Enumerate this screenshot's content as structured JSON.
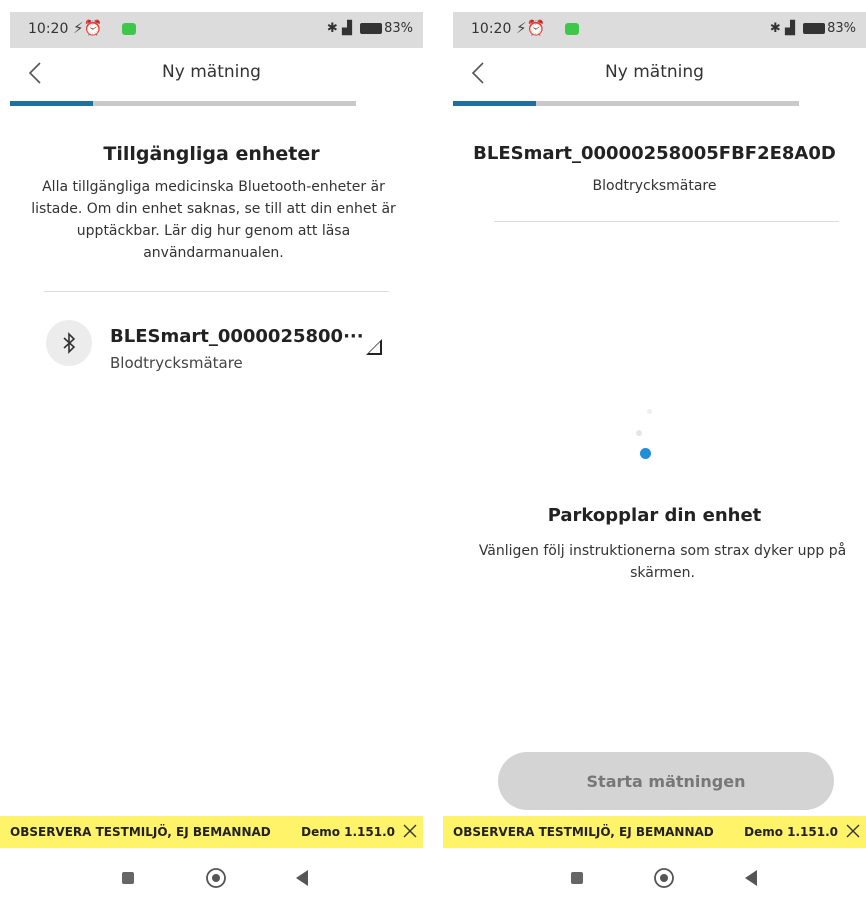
{
  "status_bar": {
    "time": "10:20",
    "right_text": "83",
    "percent_sign": "%",
    "icons": [
      "notification-icon",
      "alarm-icon",
      "app-icon",
      "bluetooth-icon",
      "sim-icon",
      "signal-4g-icon",
      "battery-icon"
    ]
  },
  "left_screen": {
    "header_title": "Ny mätning",
    "progress_fraction": 0.24,
    "section_title": "Tillgängliga enheter",
    "description": "Alla tillgängliga medicinska Bluetooth-enheter är listade. Om din enhet saknas, se till att din enhet är upptäckbar. Lär dig hur genom att läsa användarmanualen.",
    "device": {
      "name": "BLESmart_0000025800···",
      "type": "Blodtrycksmätare",
      "icon": "bluetooth-icon",
      "signal_icon": "signal-strength-icon"
    }
  },
  "right_screen": {
    "header_title": "Ny mätning",
    "progress_fraction": 0.24,
    "device_name": "BLESmart_00000258005FBF2E8A0D",
    "device_type": "Blodtrycksmätare",
    "pairing_title": "Parkopplar din enhet",
    "pairing_text": "Vänligen följ instruktionerna som strax dyker upp på skärmen.",
    "start_button": "Starta mätningen"
  },
  "banner": {
    "warning": "OBSERVERA TESTMILJÖ, EJ BEMANNAD",
    "version": "Demo 1.151.0"
  },
  "colors": {
    "accent": "#1f6fa3",
    "spinner": "#1f8fd6",
    "banner_bg": "#fff36a",
    "disabled_button": "#d4d4d4"
  }
}
